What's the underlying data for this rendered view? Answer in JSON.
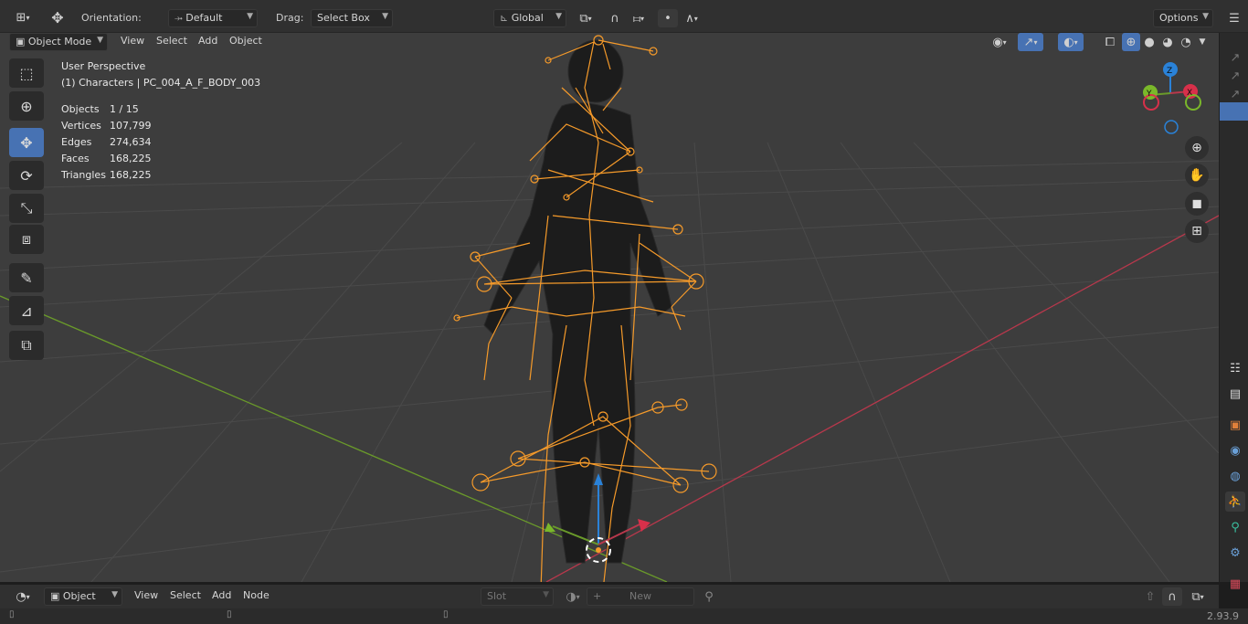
{
  "topbar": {
    "orientation_label": "Orientation:",
    "orientation_value": "Default",
    "drag_label": "Drag:",
    "drag_value": "Select Box",
    "transform_orientation": "Global",
    "options_label": "Options"
  },
  "header": {
    "mode": "Object Mode",
    "menus": [
      "View",
      "Select",
      "Add",
      "Object"
    ]
  },
  "viewport": {
    "perspective": "User Perspective",
    "collection": "(1) Characters | PC_004_A_F_BODY_003",
    "stats": [
      {
        "label": "Objects",
        "value": "1 / 15"
      },
      {
        "label": "Vertices",
        "value": "107,799"
      },
      {
        "label": "Edges",
        "value": "274,634"
      },
      {
        "label": "Faces",
        "value": "168,225"
      },
      {
        "label": "Triangles",
        "value": "168,225"
      }
    ],
    "gizmo_axis_z": "Z",
    "gizmo_axis_y": "Y",
    "gizmo_axis_x": "X"
  },
  "nodebar": {
    "editor": "Object",
    "menus": [
      "View",
      "Select",
      "Add",
      "Node"
    ],
    "slot": "Slot",
    "new_label": "New"
  },
  "statusbar": {
    "version": "2.93.9"
  },
  "colors": {
    "accent": "#4772b3",
    "armature": "#f59a2a",
    "x_axis": "#b8384c",
    "y_axis": "#6a9a2a",
    "z_axis": "#2a82d8"
  }
}
